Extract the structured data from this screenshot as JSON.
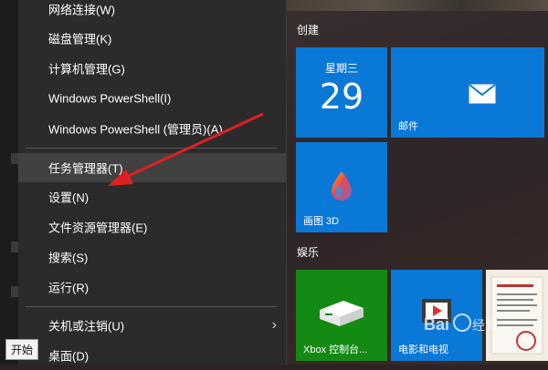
{
  "context_menu": {
    "items": [
      {
        "label": "网络连接(W)"
      },
      {
        "label": "磁盘管理(K)"
      },
      {
        "label": "计算机管理(G)"
      },
      {
        "label": "Windows PowerShell(I)"
      },
      {
        "label": "Windows PowerShell (管理员)(A)"
      },
      {
        "label": "任务管理器(T)"
      },
      {
        "label": "设置(N)"
      },
      {
        "label": "文件资源管理器(E)"
      },
      {
        "label": "搜索(S)"
      },
      {
        "label": "运行(R)"
      },
      {
        "label": "关机或注销(U)"
      },
      {
        "label": "桌面(D)"
      }
    ],
    "highlighted": "任务管理器(T)"
  },
  "start_menu": {
    "group_create": "创建",
    "group_entertainment": "娱乐",
    "tiles": {
      "calendar": {
        "day": "星期三",
        "date": "29"
      },
      "mail": {
        "label": "邮件"
      },
      "paint3d": {
        "label": "画图 3D"
      },
      "xbox": {
        "label": "Xbox 控制台..."
      },
      "movies": {
        "label": "电影和电视"
      }
    }
  },
  "tooltip": {
    "start": "开始"
  },
  "colors": {
    "tile_blue": "#0a78d7",
    "xbox_green": "#138a13",
    "arrow_red": "#e02020"
  }
}
